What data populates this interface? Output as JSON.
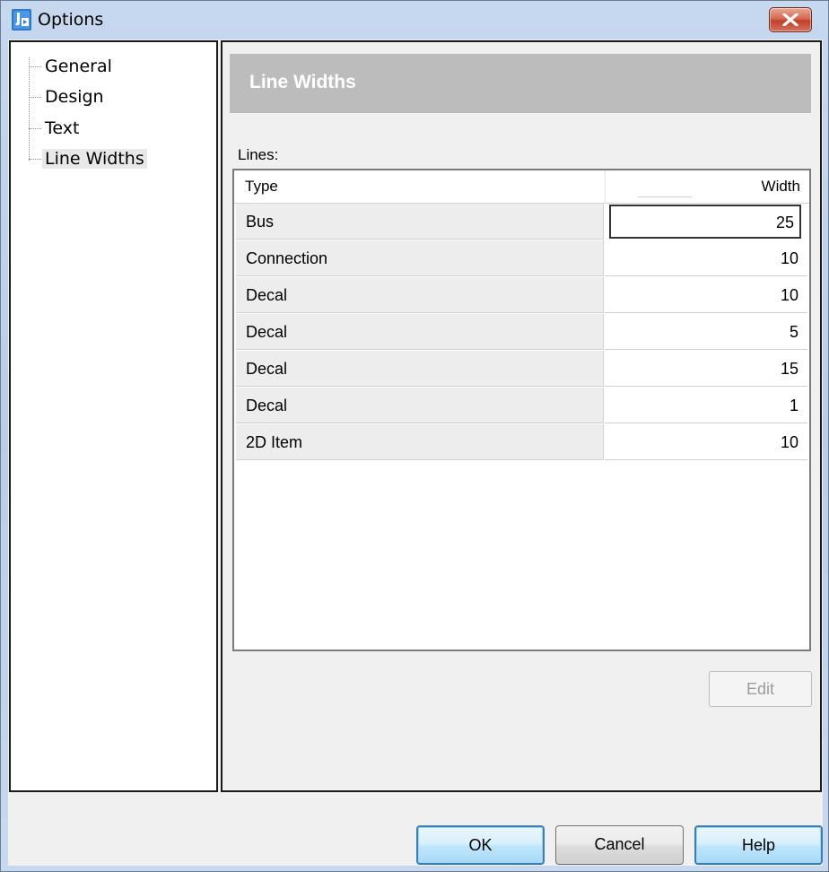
{
  "window": {
    "title": "Options"
  },
  "tree": {
    "items": [
      {
        "label": "General",
        "selected": false
      },
      {
        "label": "Design",
        "selected": false
      },
      {
        "label": "Text",
        "selected": false
      },
      {
        "label": "Line Widths",
        "selected": true
      }
    ]
  },
  "panel": {
    "header": "Line Widths",
    "lines_label": "Lines:",
    "columns": [
      "Type",
      "Width"
    ],
    "rows": [
      {
        "type": "Bus",
        "width": "25"
      },
      {
        "type": "Connection",
        "width": "10"
      },
      {
        "type": "Decal",
        "width": "10"
      },
      {
        "type": "Decal",
        "width": "5"
      },
      {
        "type": "Decal",
        "width": "15"
      },
      {
        "type": "Decal",
        "width": "1"
      },
      {
        "type": "2D Item",
        "width": "10"
      }
    ],
    "edit_label": "Edit"
  },
  "buttons": {
    "ok": "OK",
    "cancel": "Cancel",
    "help": "Help"
  },
  "icons": {
    "app": "app-icon",
    "close": "close-icon"
  },
  "colors": {
    "header_bg": "#bcbcbc",
    "close_red": "#c2402a",
    "focus_blue": "#3c7fb1"
  }
}
